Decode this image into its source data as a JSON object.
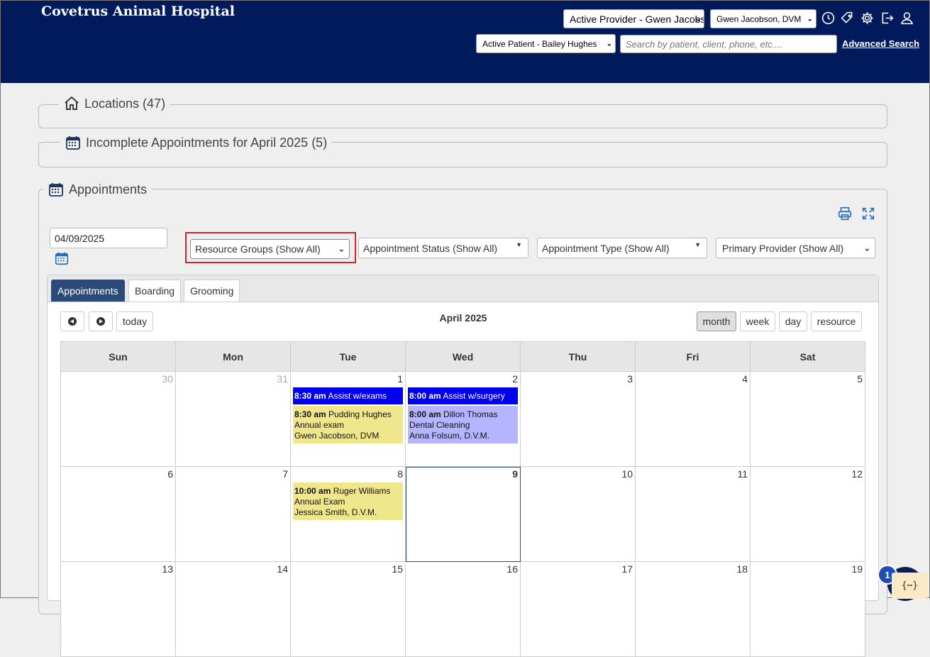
{
  "header": {
    "title": "Covetrus Animal Hospital",
    "active_provider": "Active Provider - Gwen Jacobson",
    "provider_select": "Gwen Jacobson, DVM",
    "active_patient": "Active Patient - Bailey Hughes",
    "search_placeholder": "Search by patient, client, phone, etc....",
    "advanced_search": "Advanced Search",
    "icons": [
      "clock-icon",
      "tag-icon",
      "gear-icon",
      "logout-icon",
      "user-icon"
    ]
  },
  "panels": {
    "locations": "Locations (47)",
    "incomplete": "Incomplete Appointments for April 2025 (5)",
    "appointments": "Appointments"
  },
  "filters": {
    "date": "04/09/2025",
    "resource_groups": "Resource Groups (Show All)",
    "appointment_status": "Appointment Status (Show All)",
    "appointment_type": "Appointment Type (Show All)",
    "primary_provider": "Primary Provider (Show All)"
  },
  "tabs": [
    "Appointments",
    "Boarding",
    "Grooming"
  ],
  "calendar": {
    "title": "April 2025",
    "today_label": "today",
    "views": [
      "month",
      "week",
      "day",
      "resource"
    ],
    "weekdays": [
      "Sun",
      "Mon",
      "Tue",
      "Wed",
      "Thu",
      "Fri",
      "Sat"
    ],
    "weeks": [
      [
        {
          "day": "30",
          "other": true,
          "events": []
        },
        {
          "day": "31",
          "other": true,
          "events": []
        },
        {
          "day": "1",
          "events": [
            {
              "time": "8:30 am",
              "line1": "Assist w/exams",
              "color": "#0000ee"
            },
            {
              "time": "8:30 am",
              "line1": "Pudding Hughes",
              "line2": "Annual exam",
              "line3": "Gwen Jacobson, DVM",
              "color": "#f0e68c"
            }
          ]
        },
        {
          "day": "2",
          "events": [
            {
              "time": "8:00 am",
              "line1": "Assist w/surgery",
              "color": "#0000ee"
            },
            {
              "time": "8:00 am",
              "line1": "Dillon Thomas",
              "line2": "Dental Cleaning",
              "line3": "Anna Folsum, D.V.M.",
              "color": "#b4b4ff"
            }
          ]
        },
        {
          "day": "3",
          "events": []
        },
        {
          "day": "4",
          "events": []
        },
        {
          "day": "5",
          "events": []
        }
      ],
      [
        {
          "day": "6",
          "events": []
        },
        {
          "day": "7",
          "events": []
        },
        {
          "day": "8",
          "events": [
            {
              "time": "10:00 am",
              "line1": "Ruger Williams",
              "line2": "Annual Exam",
              "line3": "Jessica Smith, D.V.M.",
              "color": "#f0e68c"
            }
          ]
        },
        {
          "day": "9",
          "today": true,
          "events": []
        },
        {
          "day": "10",
          "events": []
        },
        {
          "day": "11",
          "events": []
        },
        {
          "day": "12",
          "events": []
        }
      ],
      [
        {
          "day": "13",
          "events": []
        },
        {
          "day": "14",
          "events": []
        },
        {
          "day": "15",
          "events": []
        },
        {
          "day": "16",
          "events": []
        },
        {
          "day": "17",
          "events": []
        },
        {
          "day": "18",
          "events": []
        },
        {
          "day": "19",
          "events": []
        }
      ]
    ]
  },
  "chat": {
    "badge": "1",
    "dev_tag": "{⋯}"
  }
}
